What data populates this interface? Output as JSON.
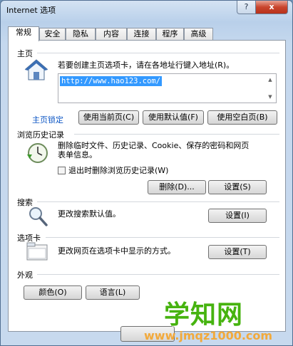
{
  "window": {
    "title": "Internet 选项",
    "help_label": "?",
    "close_label": "x"
  },
  "tabs": [
    {
      "label": "常规",
      "active": true
    },
    {
      "label": "安全"
    },
    {
      "label": "隐私"
    },
    {
      "label": "内容"
    },
    {
      "label": "连接"
    },
    {
      "label": "程序"
    },
    {
      "label": "高级"
    }
  ],
  "home": {
    "title": "主页",
    "description": "若要创建主页选项卡，请在各地址行键入地址(R)。",
    "url_value": "http://www.hao123.com/",
    "lock_link": "主页锁定",
    "use_current": "使用当前页(C)",
    "use_default": "使用默认值(F)",
    "use_blank": "使用空白页(B)"
  },
  "history": {
    "title": "浏览历史记录",
    "description_line1": "删除临时文件、历史记录、Cookie、保存的密码和网页",
    "description_line2": "表单信息。",
    "exit_checkbox": "退出时删除浏览历史记录(W)",
    "delete_button": "删除(D)...",
    "settings_button": "设置(S)"
  },
  "search": {
    "title": "搜索",
    "description": "更改搜索默认值。",
    "settings_button": "设置(I)"
  },
  "tabs_section": {
    "title": "选项卡",
    "description": "更改网页在选项卡中显示的方式。",
    "settings_button": "设置(T)"
  },
  "appearance": {
    "title": "外观",
    "colors_button": "颜色(O)",
    "language_button": "语言(L)"
  },
  "watermark": {
    "title": "学知网",
    "url": "www.jmqz1000.com"
  }
}
